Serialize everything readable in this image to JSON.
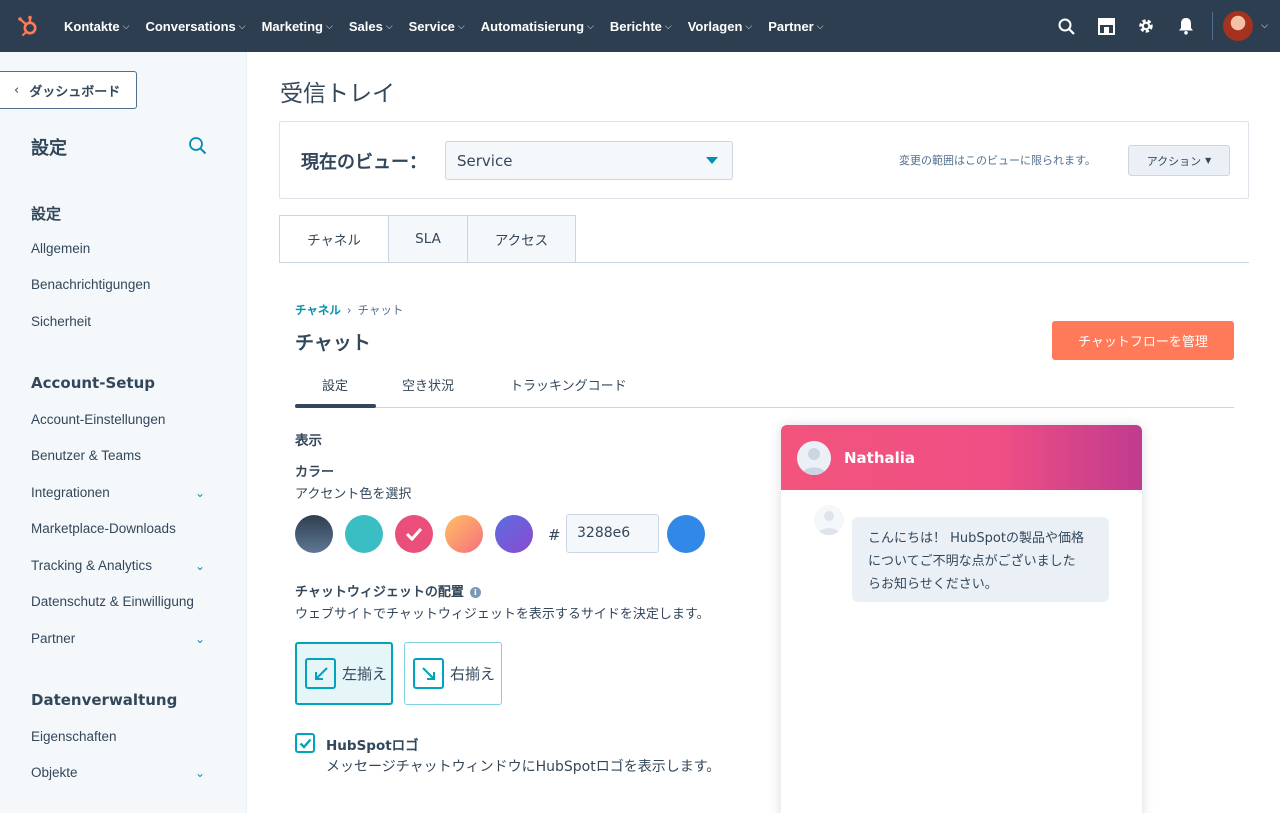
{
  "nav": {
    "items": [
      "Kontakte",
      "Conversations",
      "Marketing",
      "Sales",
      "Service",
      "Automatisierung",
      "Berichte",
      "Vorlagen",
      "Partner"
    ]
  },
  "sidebar": {
    "back_label": "ダッシュボード",
    "title": "設定",
    "sections": [
      {
        "heading": "設定",
        "items": [
          {
            "label": "Allgemein",
            "expand": false
          },
          {
            "label": "Benachrichtigungen",
            "expand": false
          },
          {
            "label": "Sicherheit",
            "expand": false
          }
        ]
      },
      {
        "heading": "Account-Setup",
        "items": [
          {
            "label": "Account-Einstellungen",
            "expand": false
          },
          {
            "label": "Benutzer & Teams",
            "expand": false
          },
          {
            "label": "Integrationen",
            "expand": true
          },
          {
            "label": "Marketplace-Downloads",
            "expand": false
          },
          {
            "label": "Tracking & Analytics",
            "expand": true
          },
          {
            "label": "Datenschutz & Einwilligung",
            "expand": false
          },
          {
            "label": "Partner",
            "expand": true
          }
        ]
      },
      {
        "heading": "Datenverwaltung",
        "items": [
          {
            "label": "Eigenschaften",
            "expand": false
          },
          {
            "label": "Objekte",
            "expand": true
          }
        ]
      }
    ]
  },
  "main": {
    "page_title": "受信トレイ",
    "view_label": "現在のビュー：",
    "view_value": "Service",
    "view_note": "変更の範囲はこのビューに限られます。",
    "action_label": "アクション",
    "tabs": [
      "チャネル",
      "SLA",
      "アクセス"
    ],
    "breadcrumb": {
      "parent": "チャネル",
      "current": "チャット"
    },
    "chat_title": "チャット",
    "flow_button": "チャットフローを管理",
    "subtabs": [
      "設定",
      "空き状況",
      "トラッキングコード"
    ],
    "display_heading": "表示",
    "color_label": "カラー",
    "color_hint": "アクセント色を選択",
    "swatches": [
      "#425b76",
      "#3bbdc4",
      "#ea4f7b",
      "#f6a05c",
      "#7260db"
    ],
    "hex_value": "3288e6",
    "accent_color": "#3288e6",
    "placement_label": "チャットウィジェットの配置",
    "placement_desc": "ウェブサイトでチャットウィジェットを表示するサイドを決定します。",
    "align_left": "左揃え",
    "align_right": "右揃え",
    "logo_label": "HubSpotロゴ",
    "logo_desc": "メッセージチャットウィンドウにHubSpotロゴを表示します。"
  },
  "preview": {
    "name": "Nathalia",
    "message_line1": "こんにちは！ HubSpotの製品や価格",
    "message_line2": "についてご不明な点がございました",
    "message_line3": "らお知らせください。"
  }
}
